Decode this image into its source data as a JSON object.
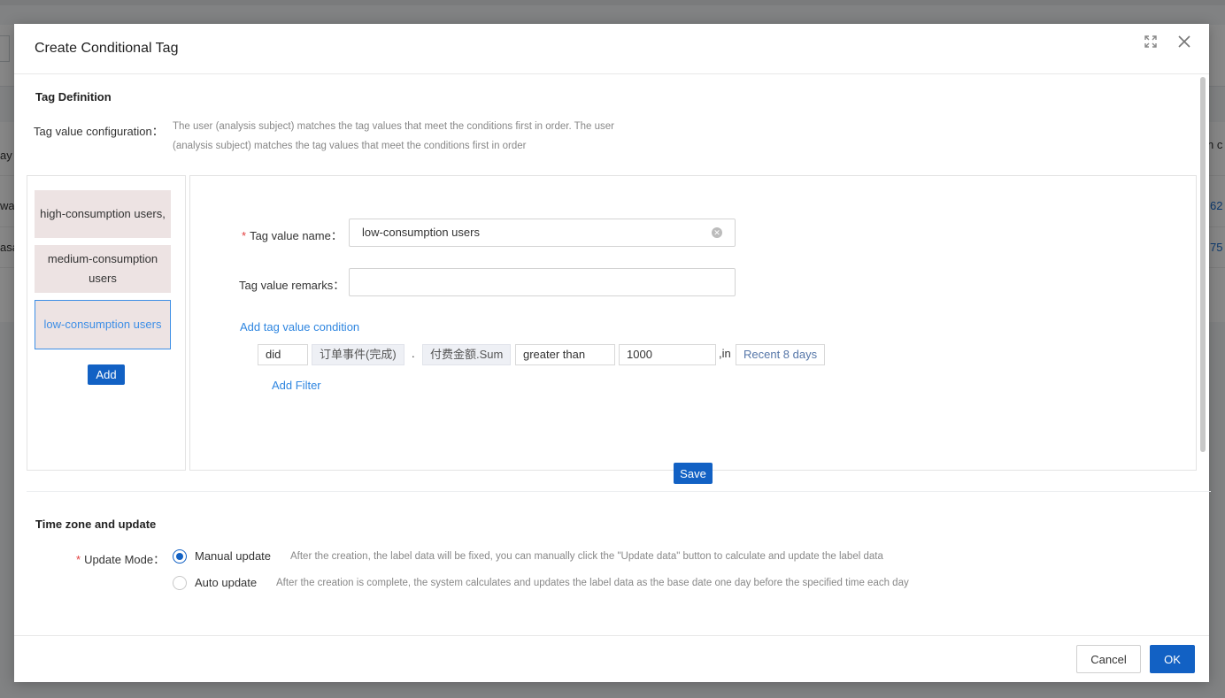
{
  "background": {
    "col_header_left": "ay",
    "col_header_right": "n c",
    "row1_left": "wa",
    "row1_right": "62",
    "row2_left": "asa",
    "row2_right": "75"
  },
  "modal": {
    "title": "Create Conditional Tag",
    "expand_icon": "expand-icon",
    "close_icon": "close-icon"
  },
  "tag_definition": {
    "section_title": "Tag Definition",
    "config_label": "Tag value configuration：",
    "config_description": "The user (analysis subject) matches the tag values that meet the conditions first in order. The user (analysis subject) matches the tag values that meet the conditions first in order",
    "tag_values": [
      {
        "label": "high-consumption users,"
      },
      {
        "label": "medium-consumption users"
      },
      {
        "label": "low-consumption users"
      }
    ],
    "add_label": "Add"
  },
  "form": {
    "name_label": "Tag value name：",
    "name_value": "low-consumption users",
    "remarks_label": "Tag value remarks：",
    "remarks_value": "",
    "add_condition_label": "Add tag value condition",
    "condition": {
      "did": "did",
      "event": "订单事件(完成)",
      "dot": ".",
      "metric": "付费金额.Sum",
      "operator": "greater than",
      "value": "1000",
      "in_text": ",in",
      "range": "Recent 8 days"
    },
    "add_filter_label": "Add Filter",
    "save_label": "Save"
  },
  "time_zone": {
    "section_title": "Time zone and update",
    "mode_label": "Update Mode：",
    "options": [
      {
        "label": "Manual update",
        "description": "After the creation, the label data will be fixed, you can manually click the \"Update data\" button to calculate and update the label data",
        "selected": true
      },
      {
        "label": "Auto update",
        "description": "After the creation is complete, the system calculates and updates the label data as the base date one day before the specified time each day",
        "selected": false
      }
    ]
  },
  "footer": {
    "cancel_label": "Cancel",
    "ok_label": "OK"
  },
  "colors": {
    "primary": "#1261c4",
    "link": "#2f86e0",
    "required": "#e23c3c",
    "tag_item_bg": "#ede3e3"
  }
}
